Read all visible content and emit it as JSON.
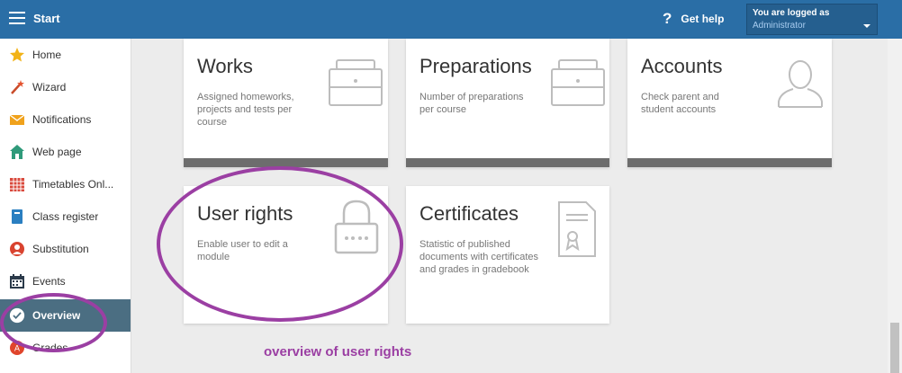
{
  "header": {
    "title": "Start",
    "help_label": "Get help",
    "help_icon_glyph": "?",
    "logged_label": "You are logged as",
    "logged_user": "Administrator"
  },
  "sidebar": {
    "items": [
      {
        "label": "Home",
        "icon": "star-icon"
      },
      {
        "label": "Wizard",
        "icon": "wand-icon"
      },
      {
        "label": "Notifications",
        "icon": "envelope-icon"
      },
      {
        "label": "Web page",
        "icon": "house-icon"
      },
      {
        "label": "Timetables Onl...",
        "icon": "grid-icon"
      },
      {
        "label": "Class register",
        "icon": "book-icon"
      },
      {
        "label": "Substitution",
        "icon": "person-icon"
      },
      {
        "label": "Events",
        "icon": "calendar-icon"
      },
      {
        "label": "Overview",
        "icon": "check-icon",
        "active": true
      },
      {
        "label": "Grades",
        "icon": "grade-icon"
      }
    ]
  },
  "cards": {
    "works": {
      "title": "Works",
      "desc": "Assigned homeworks, projects and tests per course"
    },
    "preparations": {
      "title": "Preparations",
      "desc": "Number of preparations per course"
    },
    "accounts": {
      "title": "Accounts",
      "desc": "Check parent and student accounts"
    },
    "user_rights": {
      "title": "User rights",
      "desc": "Enable user to edit a module"
    },
    "certificates": {
      "title": "Certificates",
      "desc": "Statistic of published documents with certificates and grades in gradebook"
    }
  },
  "annotation": {
    "text": "overview of user rights",
    "color": "#9b3fa3"
  },
  "colors": {
    "header": "#2a6ea6",
    "active_item": "#4b6e82",
    "card_bar": "#6d6d6d"
  }
}
